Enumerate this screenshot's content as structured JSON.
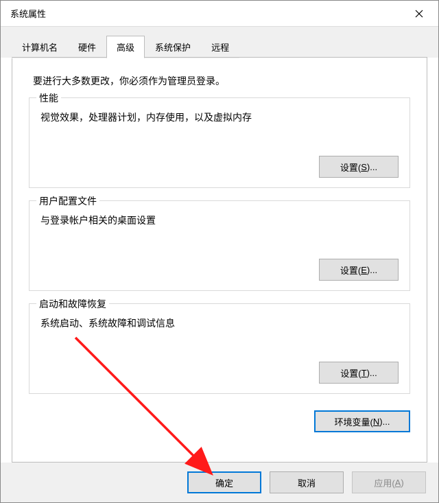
{
  "window": {
    "title": "系统属性"
  },
  "tabs": {
    "computer_name": "计算机名",
    "hardware": "硬件",
    "advanced": "高级",
    "system_protection": "系统保护",
    "remote": "远程"
  },
  "content": {
    "intro": "要进行大多数更改，你必须作为管理员登录。",
    "performance": {
      "legend": "性能",
      "desc": "视觉效果，处理器计划，内存使用，以及虚拟内存",
      "button_prefix": "设置(",
      "button_key": "S",
      "button_suffix": ")..."
    },
    "user_profiles": {
      "legend": "用户配置文件",
      "desc": "与登录帐户相关的桌面设置",
      "button_prefix": "设置(",
      "button_key": "E",
      "button_suffix": ")..."
    },
    "startup": {
      "legend": "启动和故障恢复",
      "desc": "系统启动、系统故障和调试信息",
      "button_prefix": "设置(",
      "button_key": "T",
      "button_suffix": ")..."
    },
    "env": {
      "button_prefix": "环境变量(",
      "button_key": "N",
      "button_suffix": ")..."
    }
  },
  "footer": {
    "ok": "确定",
    "cancel": "取消",
    "apply_prefix": "应用(",
    "apply_key": "A",
    "apply_suffix": ")"
  }
}
